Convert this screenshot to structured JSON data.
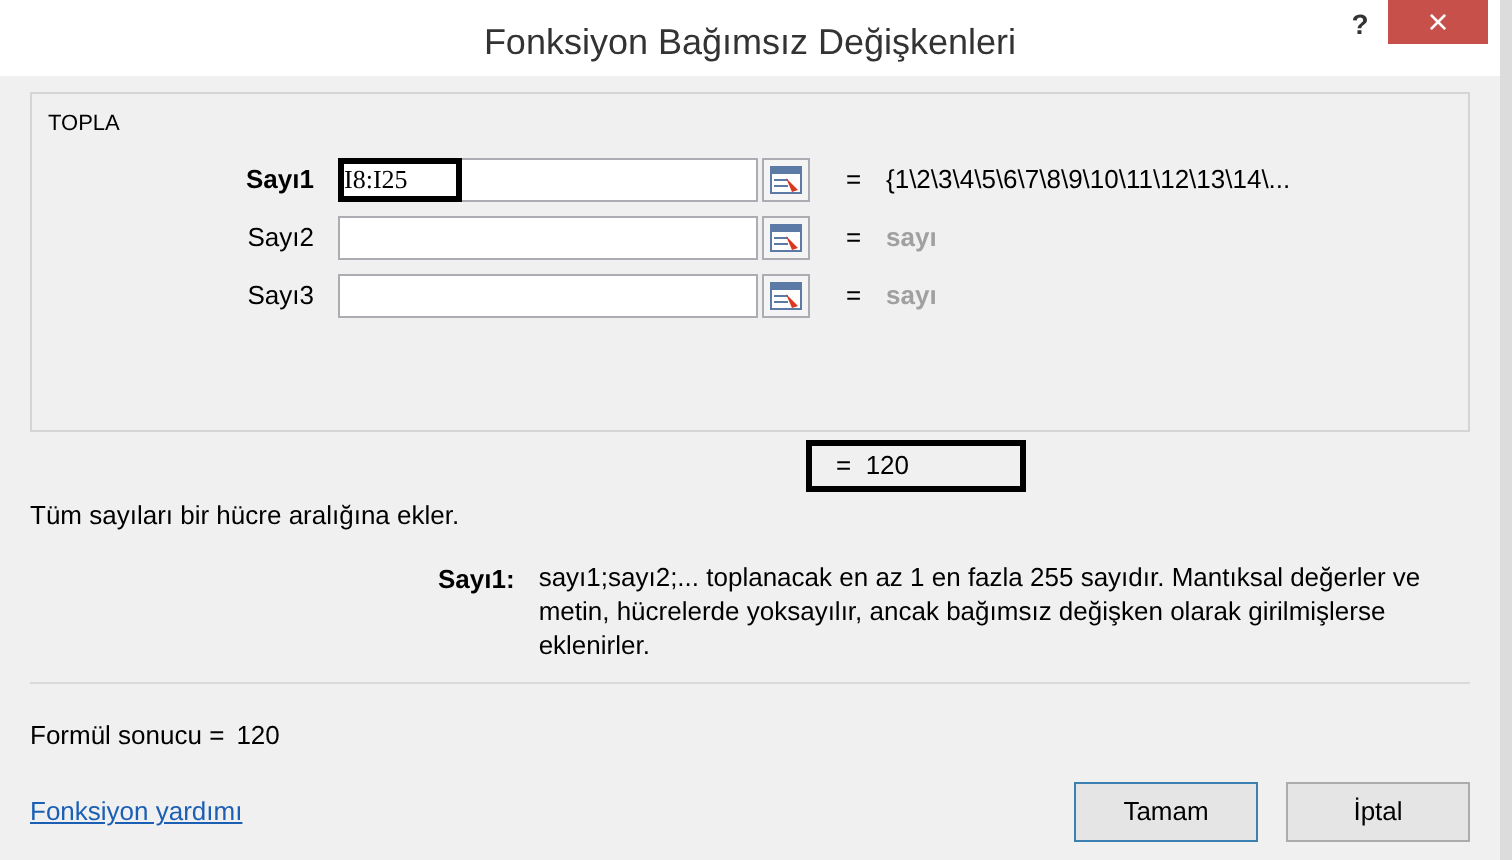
{
  "window": {
    "title": "Fonksiyon Bağımsız Değişkenleri",
    "help": "?",
    "close": "×"
  },
  "function_group": {
    "name": "TOPLA",
    "arguments": [
      {
        "label": "Sayı1",
        "value": "I8:I25",
        "equals": "=",
        "result": "{1\\2\\3\\4\\5\\6\\7\\8\\9\\10\\11\\12\\13\\14\\...",
        "active": true,
        "highlighted": true
      },
      {
        "label": "Sayı2",
        "equals": "=",
        "result": "sayı",
        "active": false,
        "highlighted": false
      },
      {
        "label": "Sayı3",
        "equals": "=",
        "result": "sayı",
        "active": false,
        "highlighted": false
      }
    ]
  },
  "function_result": {
    "text": "=  120",
    "highlighted": true
  },
  "description": "Tüm sayıları bir hücre aralığına ekler.",
  "argument_help": {
    "label": "Sayı1:",
    "text": "sayı1;sayı2;... toplanacak en az 1 en fazla 255 sayıdır. Mantıksal değerler ve metin, hücrelerde yoksayılır, ancak bağımsız değişken olarak girilmişlerse eklenirler."
  },
  "formula_result": {
    "label": "Formül sonucu =",
    "value": "120"
  },
  "help_link": "Fonksiyon yardımı",
  "buttons": [
    {
      "label": "Tamam",
      "default": true
    },
    {
      "label": "İptal",
      "default": false
    }
  ]
}
